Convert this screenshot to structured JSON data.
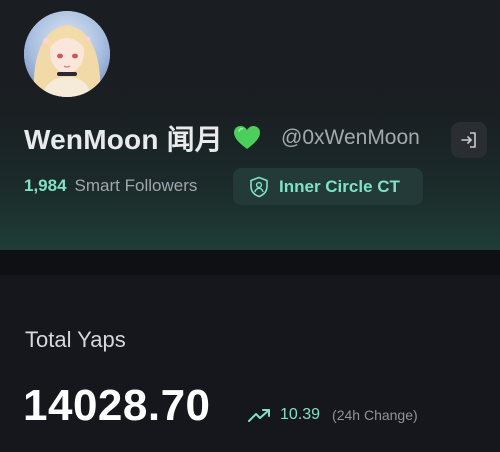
{
  "profile": {
    "display_name": "WenMoon 闻月",
    "heart_icon": "green-heart-icon",
    "handle": "@0xWenMoon",
    "login_icon": "sign-in-icon",
    "smart_followers_count": "1,984",
    "smart_followers_label": "Smart Followers",
    "badge_icon": "shield-badge-icon",
    "badge_label": "Inner Circle CT"
  },
  "stats": {
    "title": "Total Yaps",
    "value": "14028.70",
    "change_icon": "trending-up-icon",
    "change_value": "10.39",
    "change_label": "(24h Change)"
  },
  "colors": {
    "accent": "#7fe3c3",
    "background": "#16171c",
    "heart": "#4ccf5a"
  }
}
